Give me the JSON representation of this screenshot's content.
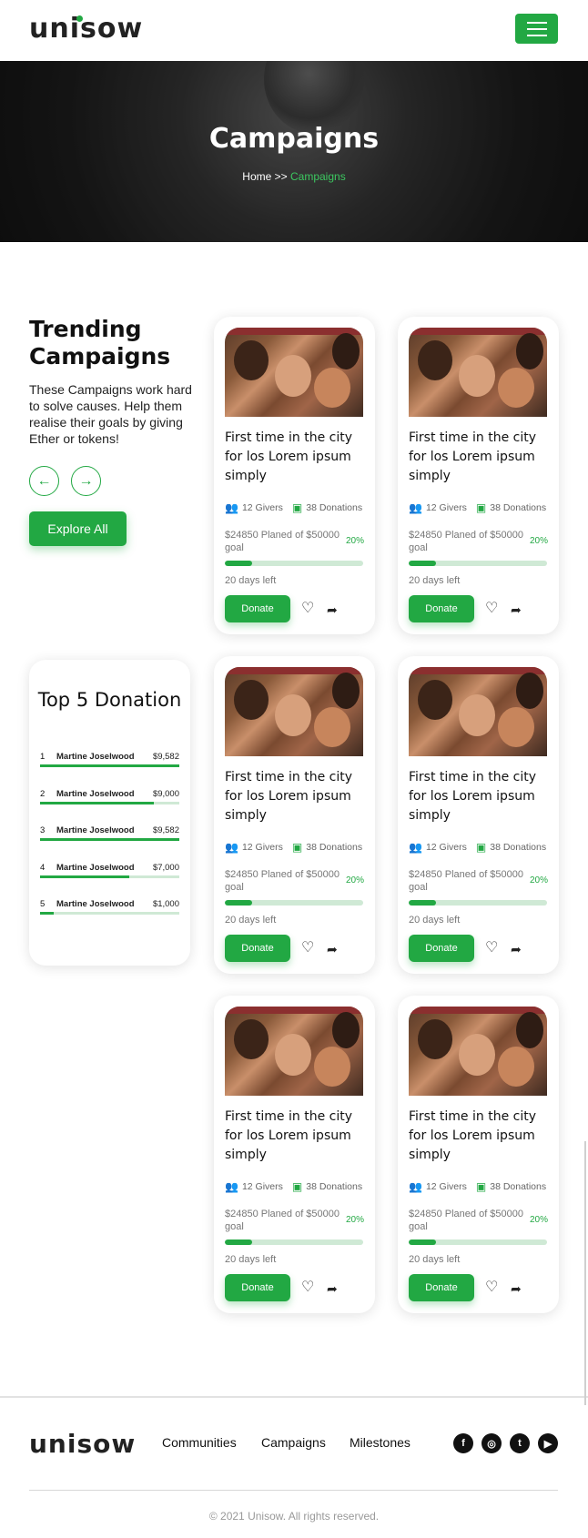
{
  "header": {
    "logo": "unisow",
    "menu_icon": "hamburger-icon"
  },
  "hero": {
    "title": "Campaigns",
    "breadcrumb_home": "Home >>",
    "breadcrumb_current": "Campaigns"
  },
  "trending": {
    "title": "Trending Campaigns",
    "description": "These Campaigns work hard to solve causes. Help them realise their goals by giving Ether or tokens!",
    "prev_icon": "←",
    "next_icon": "→",
    "explore_label": "Explore All"
  },
  "campaigns": [
    {
      "title": "First time in the city for los Lorem ipsum simply",
      "givers": "12 Givers",
      "donations": "38 Donations",
      "goal": "$24850 Planed of $50000 goal",
      "percent": "20%",
      "progress": 0.2,
      "days": "20 days left",
      "donate_label": "Donate"
    },
    {
      "title": "First time in the city for los Lorem ipsum simply",
      "givers": "12 Givers",
      "donations": "38 Donations",
      "goal": "$24850 Planed of $50000 goal",
      "percent": "20%",
      "progress": 0.2,
      "days": "20 days left",
      "donate_label": "Donate"
    },
    {
      "title": "First time in the city for los Lorem ipsum simply",
      "givers": "12 Givers",
      "donations": "38 Donations",
      "goal": "$24850 Planed of $50000 goal",
      "percent": "20%",
      "progress": 0.2,
      "days": "20 days left",
      "donate_label": "Donate"
    },
    {
      "title": "First time in the city for los Lorem ipsum simply",
      "givers": "12 Givers",
      "donations": "38 Donations",
      "goal": "$24850 Planed of $50000 goal",
      "percent": "20%",
      "progress": 0.2,
      "days": "20 days left",
      "donate_label": "Donate"
    },
    {
      "title": "First time in the city for los Lorem ipsum simply",
      "givers": "12 Givers",
      "donations": "38 Donations",
      "goal": "$24850 Planed of $50000 goal",
      "percent": "20%",
      "progress": 0.2,
      "days": "20 days left",
      "donate_label": "Donate"
    },
    {
      "title": "First time in the city for los Lorem ipsum simply",
      "givers": "12 Givers",
      "donations": "38 Donations",
      "goal": "$24850 Planed of $50000 goal",
      "percent": "20%",
      "progress": 0.2,
      "days": "20 days left",
      "donate_label": "Donate"
    }
  ],
  "top5": {
    "title": "Top 5 Donation",
    "rows": [
      {
        "rank": "1",
        "name": "Martine Joselwood",
        "amount": "$9,582",
        "progress": 1.0
      },
      {
        "rank": "2",
        "name": "Martine Joselwood",
        "amount": "$9,000",
        "progress": 0.82
      },
      {
        "rank": "3",
        "name": "Martine Joselwood",
        "amount": "$9,582",
        "progress": 1.0
      },
      {
        "rank": "4",
        "name": "Martine Joselwood",
        "amount": "$7,000",
        "progress": 0.64
      },
      {
        "rank": "5",
        "name": "Martine Joselwood",
        "amount": "$1,000",
        "progress": 0.1
      }
    ]
  },
  "footer": {
    "logo": "unisow",
    "links": [
      "Communities",
      "Campaigns",
      "Milestones"
    ],
    "social": [
      "facebook-icon",
      "instagram-icon",
      "twitter-icon",
      "youtube-icon"
    ],
    "copyright": "© 2021 Unisow. All rights reserved."
  },
  "colors": {
    "accent": "#22a843",
    "accent_light": "#cfe9d5"
  }
}
